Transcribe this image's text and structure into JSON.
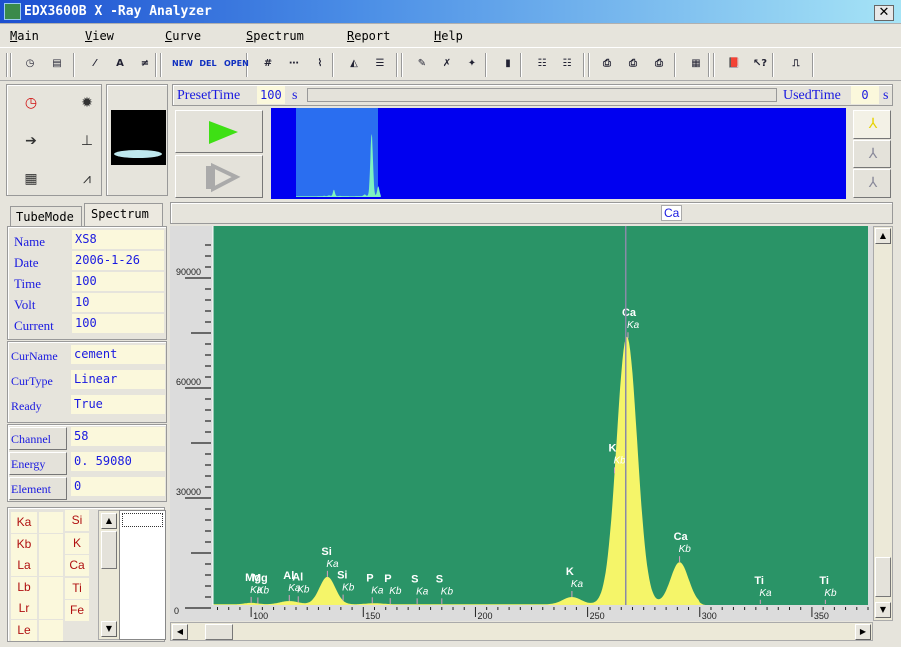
{
  "window": {
    "title": "EDX3600B X -Ray Analyzer",
    "close": "✕"
  },
  "menu": [
    "Main",
    "View",
    "Curve",
    "Spectrum",
    "Report",
    "Help"
  ],
  "toolbar": [
    {
      "icon": "clock-icon",
      "glyph": "◷"
    },
    {
      "icon": "report-icon",
      "glyph": "▤"
    },
    {
      "icon": "scale-icon",
      "glyph": "⁄"
    },
    {
      "icon": "font-icon",
      "glyph": "A"
    },
    {
      "icon": "ratio-icon",
      "glyph": "≠"
    },
    {
      "icon": "new-curve-icon",
      "glyph": "NEW"
    },
    {
      "icon": "delete-curve-icon",
      "glyph": "DEL"
    },
    {
      "icon": "open-curve-icon",
      "glyph": "OPEN"
    },
    {
      "icon": "grid-icon",
      "glyph": "#"
    },
    {
      "icon": "dotted-chart-icon",
      "glyph": "⋯"
    },
    {
      "icon": "line-chart-icon",
      "glyph": "⌇"
    },
    {
      "icon": "triangle-icon",
      "glyph": "◭"
    },
    {
      "icon": "legend-icon",
      "glyph": "☰"
    },
    {
      "icon": "doc-edit-icon",
      "glyph": "✎"
    },
    {
      "icon": "doc-delete-icon",
      "glyph": "✗"
    },
    {
      "icon": "doc-new-icon",
      "glyph": "✦"
    },
    {
      "icon": "column-icon",
      "glyph": "▮"
    },
    {
      "icon": "list-icon",
      "glyph": "☷"
    },
    {
      "icon": "dotted-list-icon",
      "glyph": "☷"
    },
    {
      "icon": "print-icon",
      "glyph": "⎙"
    },
    {
      "icon": "print-setup-icon",
      "glyph": "⎙"
    },
    {
      "icon": "print-preview-icon",
      "glyph": "⎙"
    },
    {
      "icon": "calculator-icon",
      "glyph": "▦"
    },
    {
      "icon": "book-icon",
      "glyph": "📕"
    },
    {
      "icon": "whats-this-icon",
      "glyph": "↖?"
    },
    {
      "icon": "exit-icon",
      "glyph": "⎍"
    }
  ],
  "side_tools": [
    {
      "icon": "clock-icon",
      "glyph": "◷"
    },
    {
      "icon": "new-doc-icon",
      "glyph": "✹"
    },
    {
      "icon": "import-icon",
      "glyph": "➔"
    },
    {
      "icon": "peak-chart-icon",
      "glyph": "⊥"
    },
    {
      "icon": "calculator-icon",
      "glyph": "▦"
    },
    {
      "icon": "compare-chart-icon",
      "glyph": "⩘"
    }
  ],
  "acquire": {
    "preset_label": "PresetTime",
    "preset_value": "100",
    "preset_unit": "s",
    "used_label": "UsedTime",
    "used_value": "0",
    "used_unit": "s",
    "progress": 0
  },
  "cursor_element": "Ca",
  "tabs": [
    "TubeMode",
    "Spectrum"
  ],
  "active_tab": "Spectrum",
  "spectrum_info": [
    [
      "Name",
      "XS8"
    ],
    [
      "Date",
      "2006-1-26"
    ],
    [
      "Time",
      "100"
    ],
    [
      "Volt",
      "10"
    ],
    [
      "Current",
      "100"
    ]
  ],
  "curve_info": [
    [
      "CurName",
      "cement"
    ],
    [
      "CurType",
      "Linear"
    ],
    [
      "Ready",
      "True"
    ]
  ],
  "cursor_info": [
    [
      "Channel",
      "58"
    ],
    [
      "Energy",
      "0. 59080"
    ],
    [
      "Element",
      "0"
    ]
  ],
  "lines": [
    "Ka",
    "Kb",
    "La",
    "Lb",
    "Lr",
    "Le"
  ],
  "elements": [
    "Si",
    "K",
    "Ca",
    "Ti",
    "Fe"
  ],
  "chart_data": {
    "type": "area",
    "xlim": [
      83,
      375
    ],
    "ylim": [
      0,
      100000
    ],
    "x_ticks": [
      100,
      150,
      200,
      250,
      300,
      350
    ],
    "y_ticks": [
      0,
      30000,
      60000,
      90000
    ],
    "cursor_channel": 267,
    "background_counts": 1000,
    "peaks": [
      {
        "channel": 100,
        "counts": 400,
        "sigma": 3
      },
      {
        "channel": 117,
        "counts": 900,
        "sigma": 4
      },
      {
        "channel": 134,
        "counts": 7500,
        "sigma": 3.5
      },
      {
        "channel": 155,
        "counts": 300,
        "sigma": 4
      },
      {
        "channel": 243,
        "counts": 2000,
        "sigma": 4
      },
      {
        "channel": 267.5,
        "counts": 73000,
        "sigma": 4.6
      },
      {
        "channel": 291,
        "counts": 11500,
        "sigma": 4
      }
    ],
    "peak_labels": [
      {
        "el": "Mg",
        "line": "Ka",
        "channel": 100
      },
      {
        "el": "Mg",
        "line": "Kb",
        "channel": 103
      },
      {
        "el": "Al",
        "line": "Ka",
        "channel": 117
      },
      {
        "el": "Al",
        "line": "Kb",
        "channel": 121
      },
      {
        "el": "Si",
        "line": "Ka",
        "channel": 134
      },
      {
        "el": "Si",
        "line": "Kb",
        "channel": 141
      },
      {
        "el": "P",
        "line": "Ka",
        "channel": 154
      },
      {
        "el": "P",
        "line": "Kb",
        "channel": 162
      },
      {
        "el": "S",
        "line": "Ka",
        "channel": 174
      },
      {
        "el": "S",
        "line": "Kb",
        "channel": 185
      },
      {
        "el": "K",
        "line": "Ka",
        "channel": 243
      },
      {
        "el": "K",
        "line": "Kb",
        "channel": 262
      },
      {
        "el": "Ca",
        "line": "Ka",
        "channel": 268
      },
      {
        "el": "Ca",
        "line": "Kb",
        "channel": 291
      },
      {
        "el": "Ti",
        "line": "Ka",
        "channel": 327
      },
      {
        "el": "Ti",
        "line": "Kb",
        "channel": 356
      }
    ],
    "colors": {
      "plot_bg": "#2a9467",
      "fill": "#f5f569",
      "overview_bg": "#0000f0",
      "overview_window": "#2a6ef0",
      "overview_trace": "#7ef2c0"
    }
  }
}
